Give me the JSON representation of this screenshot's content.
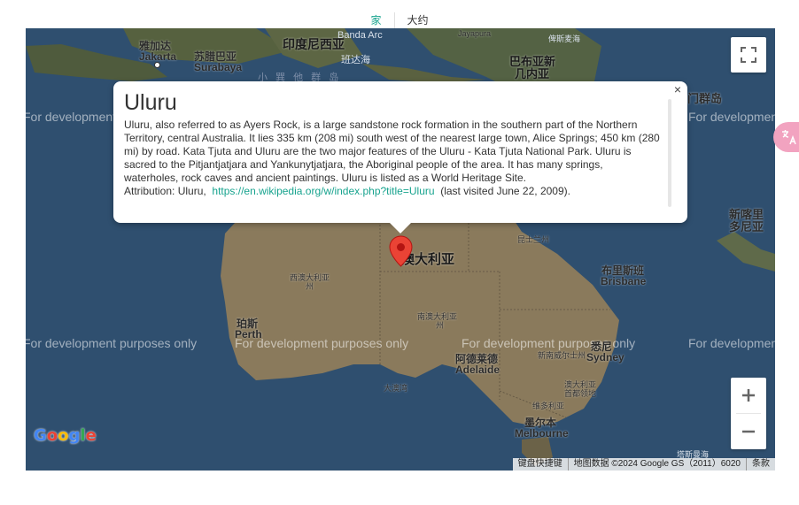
{
  "tabs": [
    {
      "label": "家",
      "active": true
    },
    {
      "label": "大约",
      "active": false
    }
  ],
  "map": {
    "watermark": "For development purposes only",
    "labels": {
      "jakarta_zh": "雅加达",
      "jakarta": "Jakarta",
      "surabaya_zh": "苏腊巴亚",
      "surabaya": "Surabaya",
      "indonesia": "印度尼西亚",
      "banda_arc": "Banda Arc",
      "banda_sea": "班达海",
      "jayapura": "Jayapura",
      "bismarck_sea": "俾斯麦海",
      "papua_ng_1": "巴布亚新",
      "papua_ng_2": "几内亚",
      "lesser_sunda": "小 巽 他 群 岛",
      "solomon": "门群岛",
      "new_caledonia_1": "新喀里",
      "new_caledonia_2": "多尼亚",
      "australia": "澳大利亚",
      "queensland": "昆士兰州",
      "western_australia_1": "西澳大利亚",
      "western_australia_2": "州",
      "south_australia_1": "南澳大利亚",
      "south_australia_2": "州",
      "brisbane_zh": "布里斯班",
      "brisbane": "Brisbane",
      "perth_zh": "珀斯",
      "perth": "Perth",
      "adelaide_zh": "阿德莱德",
      "adelaide": "Adelaide",
      "nsw": "新南威尔士州",
      "sydney_zh": "悉尼",
      "sydney": "Sydney",
      "great_australian_bight": "大澳湾",
      "victoria": "维多利亚",
      "melbourne_zh": "墨尔本",
      "melbourne": "Melbourne",
      "act_1": "澳大利亚",
      "act_2": "首都领地",
      "tasman": "塔斯曼海"
    },
    "footer": {
      "shortcuts": "键盘快捷键",
      "data": "地图数据 ©2024 Google GS（2011）6020",
      "terms": "条款"
    },
    "logo": "Google"
  },
  "info_window": {
    "title": "Uluru",
    "body": "Uluru, also referred to as Ayers Rock, is a large sandstone rock formation in the southern part of the Northern Territory, central Australia. It lies 335 km (208 mi) south west of the nearest large town, Alice Springs; 450 km (280 mi) by road. Kata Tjuta and Uluru are the two major features of the Uluru - Kata Tjuta National Park. Uluru is sacred to the Pitjantjatjara and Yankunytjatjara, the Aboriginal people of the area. It has many springs, waterholes, rock caves and ancient paintings. Uluru is listed as a World Heritage Site.",
    "attribution_prefix": "Attribution: Uluru,",
    "attribution_link": "https://en.wikipedia.org/w/index.php?title=Uluru",
    "attribution_suffix": "(last visited June 22, 2009).",
    "close": "×"
  },
  "icons": {
    "fullscreen": "fullscreen-icon",
    "zoom_in": "plus-icon",
    "zoom_out": "minus-icon",
    "marker": "map-pin-icon",
    "translate": "translate-icon"
  },
  "colors": {
    "accent": "#17a38e",
    "ocean": "#2f4f6f",
    "land": "#8a7a5c",
    "marker": "#ea4335"
  }
}
